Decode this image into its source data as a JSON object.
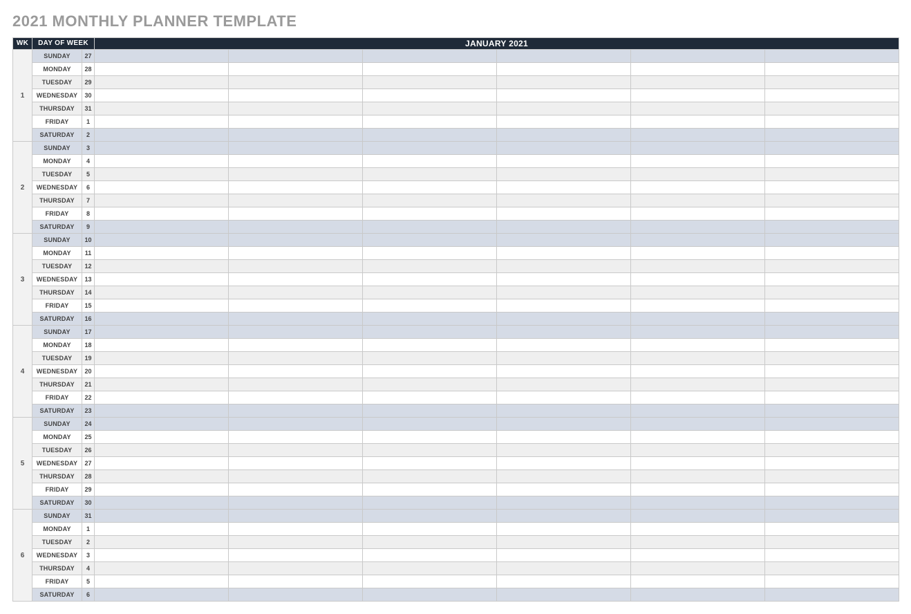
{
  "title": "2021 MONTHLY PLANNER TEMPLATE",
  "headers": {
    "wk": "WK",
    "dow": "DAY OF WEEK",
    "month": "JANUARY 2021"
  },
  "slot_count": 6,
  "weeks": [
    {
      "wk": "1",
      "days": [
        {
          "dow": "SUNDAY",
          "num": "27",
          "weekend": true,
          "alt": false
        },
        {
          "dow": "MONDAY",
          "num": "28",
          "weekend": false,
          "alt": false
        },
        {
          "dow": "TUESDAY",
          "num": "29",
          "weekend": false,
          "alt": true
        },
        {
          "dow": "WEDNESDAY",
          "num": "30",
          "weekend": false,
          "alt": false
        },
        {
          "dow": "THURSDAY",
          "num": "31",
          "weekend": false,
          "alt": true
        },
        {
          "dow": "FRIDAY",
          "num": "1",
          "weekend": false,
          "alt": false
        },
        {
          "dow": "SATURDAY",
          "num": "2",
          "weekend": true,
          "alt": false
        }
      ]
    },
    {
      "wk": "2",
      "days": [
        {
          "dow": "SUNDAY",
          "num": "3",
          "weekend": true,
          "alt": false
        },
        {
          "dow": "MONDAY",
          "num": "4",
          "weekend": false,
          "alt": false
        },
        {
          "dow": "TUESDAY",
          "num": "5",
          "weekend": false,
          "alt": true
        },
        {
          "dow": "WEDNESDAY",
          "num": "6",
          "weekend": false,
          "alt": false
        },
        {
          "dow": "THURSDAY",
          "num": "7",
          "weekend": false,
          "alt": true
        },
        {
          "dow": "FRIDAY",
          "num": "8",
          "weekend": false,
          "alt": false
        },
        {
          "dow": "SATURDAY",
          "num": "9",
          "weekend": true,
          "alt": false
        }
      ]
    },
    {
      "wk": "3",
      "days": [
        {
          "dow": "SUNDAY",
          "num": "10",
          "weekend": true,
          "alt": false
        },
        {
          "dow": "MONDAY",
          "num": "11",
          "weekend": false,
          "alt": false
        },
        {
          "dow": "TUESDAY",
          "num": "12",
          "weekend": false,
          "alt": true
        },
        {
          "dow": "WEDNESDAY",
          "num": "13",
          "weekend": false,
          "alt": false
        },
        {
          "dow": "THURSDAY",
          "num": "14",
          "weekend": false,
          "alt": true
        },
        {
          "dow": "FRIDAY",
          "num": "15",
          "weekend": false,
          "alt": false
        },
        {
          "dow": "SATURDAY",
          "num": "16",
          "weekend": true,
          "alt": false
        }
      ]
    },
    {
      "wk": "4",
      "days": [
        {
          "dow": "SUNDAY",
          "num": "17",
          "weekend": true,
          "alt": false
        },
        {
          "dow": "MONDAY",
          "num": "18",
          "weekend": false,
          "alt": false
        },
        {
          "dow": "TUESDAY",
          "num": "19",
          "weekend": false,
          "alt": true
        },
        {
          "dow": "WEDNESDAY",
          "num": "20",
          "weekend": false,
          "alt": false
        },
        {
          "dow": "THURSDAY",
          "num": "21",
          "weekend": false,
          "alt": true
        },
        {
          "dow": "FRIDAY",
          "num": "22",
          "weekend": false,
          "alt": false
        },
        {
          "dow": "SATURDAY",
          "num": "23",
          "weekend": true,
          "alt": false
        }
      ]
    },
    {
      "wk": "5",
      "days": [
        {
          "dow": "SUNDAY",
          "num": "24",
          "weekend": true,
          "alt": false
        },
        {
          "dow": "MONDAY",
          "num": "25",
          "weekend": false,
          "alt": false
        },
        {
          "dow": "TUESDAY",
          "num": "26",
          "weekend": false,
          "alt": true
        },
        {
          "dow": "WEDNESDAY",
          "num": "27",
          "weekend": false,
          "alt": false
        },
        {
          "dow": "THURSDAY",
          "num": "28",
          "weekend": false,
          "alt": true
        },
        {
          "dow": "FRIDAY",
          "num": "29",
          "weekend": false,
          "alt": false
        },
        {
          "dow": "SATURDAY",
          "num": "30",
          "weekend": true,
          "alt": false
        }
      ]
    },
    {
      "wk": "6",
      "days": [
        {
          "dow": "SUNDAY",
          "num": "31",
          "weekend": true,
          "alt": false
        },
        {
          "dow": "MONDAY",
          "num": "1",
          "weekend": false,
          "alt": false
        },
        {
          "dow": "TUESDAY",
          "num": "2",
          "weekend": false,
          "alt": true
        },
        {
          "dow": "WEDNESDAY",
          "num": "3",
          "weekend": false,
          "alt": false
        },
        {
          "dow": "THURSDAY",
          "num": "4",
          "weekend": false,
          "alt": true
        },
        {
          "dow": "FRIDAY",
          "num": "5",
          "weekend": false,
          "alt": false
        },
        {
          "dow": "SATURDAY",
          "num": "6",
          "weekend": true,
          "alt": false
        }
      ]
    }
  ]
}
